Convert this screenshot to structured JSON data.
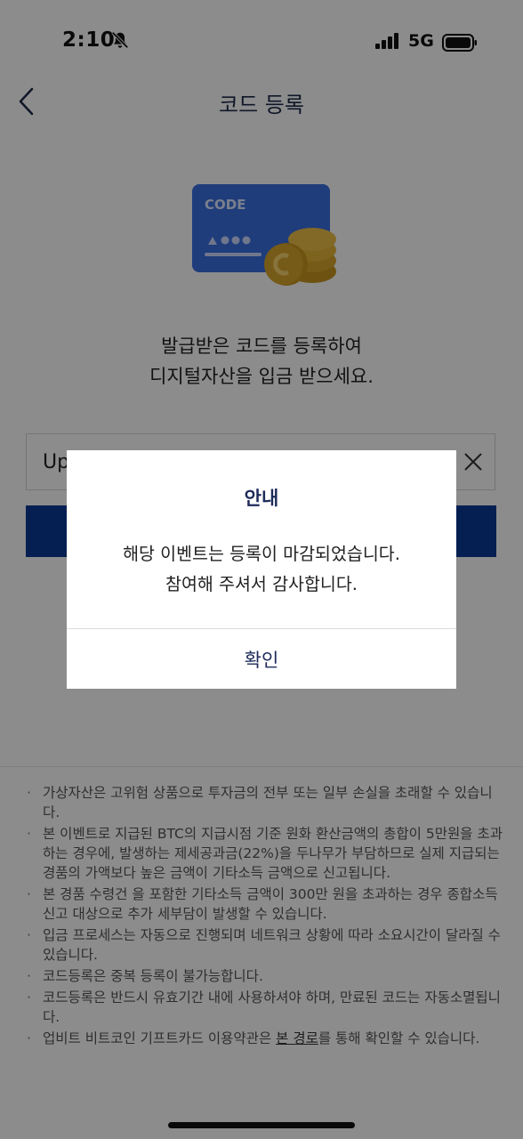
{
  "status": {
    "time": "2:10",
    "network": "5G"
  },
  "header": {
    "title": "코드 등록"
  },
  "illustration": {
    "card_text": "CODE"
  },
  "intro": {
    "line1": "발급받은 코드를 등록하여",
    "line2": "디지털자산을 입금 받으세요."
  },
  "code_field": {
    "value": "Up"
  },
  "submit": {
    "label": ""
  },
  "notices": [
    "가상자산은 고위험 상품으로 투자금의 전부 또는 일부 손실을 초래할 수 있습니다.",
    "본 이벤트로 지급된 BTC의 지급시점 기준 원화 환산금액의 총합이 5만원을 초과하는 경우에, 발생하는 제세공과금(22%)을 두나무가 부담하므로 실제 지급되는 경품의 가액보다 높은 금액이 기타소득 금액으로 신고됩니다.",
    "본 경품 수령건 을 포함한 기타소득 금액이 300만 원을 초과하는 경우 종합소득 신고 대상으로 추가 세부담이 발생할 수 있습니다.",
    "입금 프로세스는 자동으로 진행되며 네트워크 상황에 따라 소요시간이 달라질 수 있습니다.",
    "코드등록은 중복 등록이 불가능합니다.",
    "코드등록은 반드시 유효기간 내에 사용하셔야 하며, 만료된 코드는 자동소멸됩니다."
  ],
  "notice_last": {
    "before": "업비트 비트코인 기프트카드 이용약관은 ",
    "link": "본 경로",
    "after": "를 통해 확인할 수 있습니다."
  },
  "modal": {
    "title": "안내",
    "line1": "해당 이벤트는 등록이 마감되었습니다.",
    "line2": "참여해 주셔서 감사합니다.",
    "confirm": "확인"
  },
  "colors": {
    "accent": "#0a3a95",
    "title": "#1d2a5a",
    "card": "#3a6fe0",
    "coin": "#d8a52a"
  },
  "icons": [
    "bell-slash-icon",
    "signal-icon",
    "battery-icon",
    "back-chevron-icon",
    "clear-icon"
  ]
}
